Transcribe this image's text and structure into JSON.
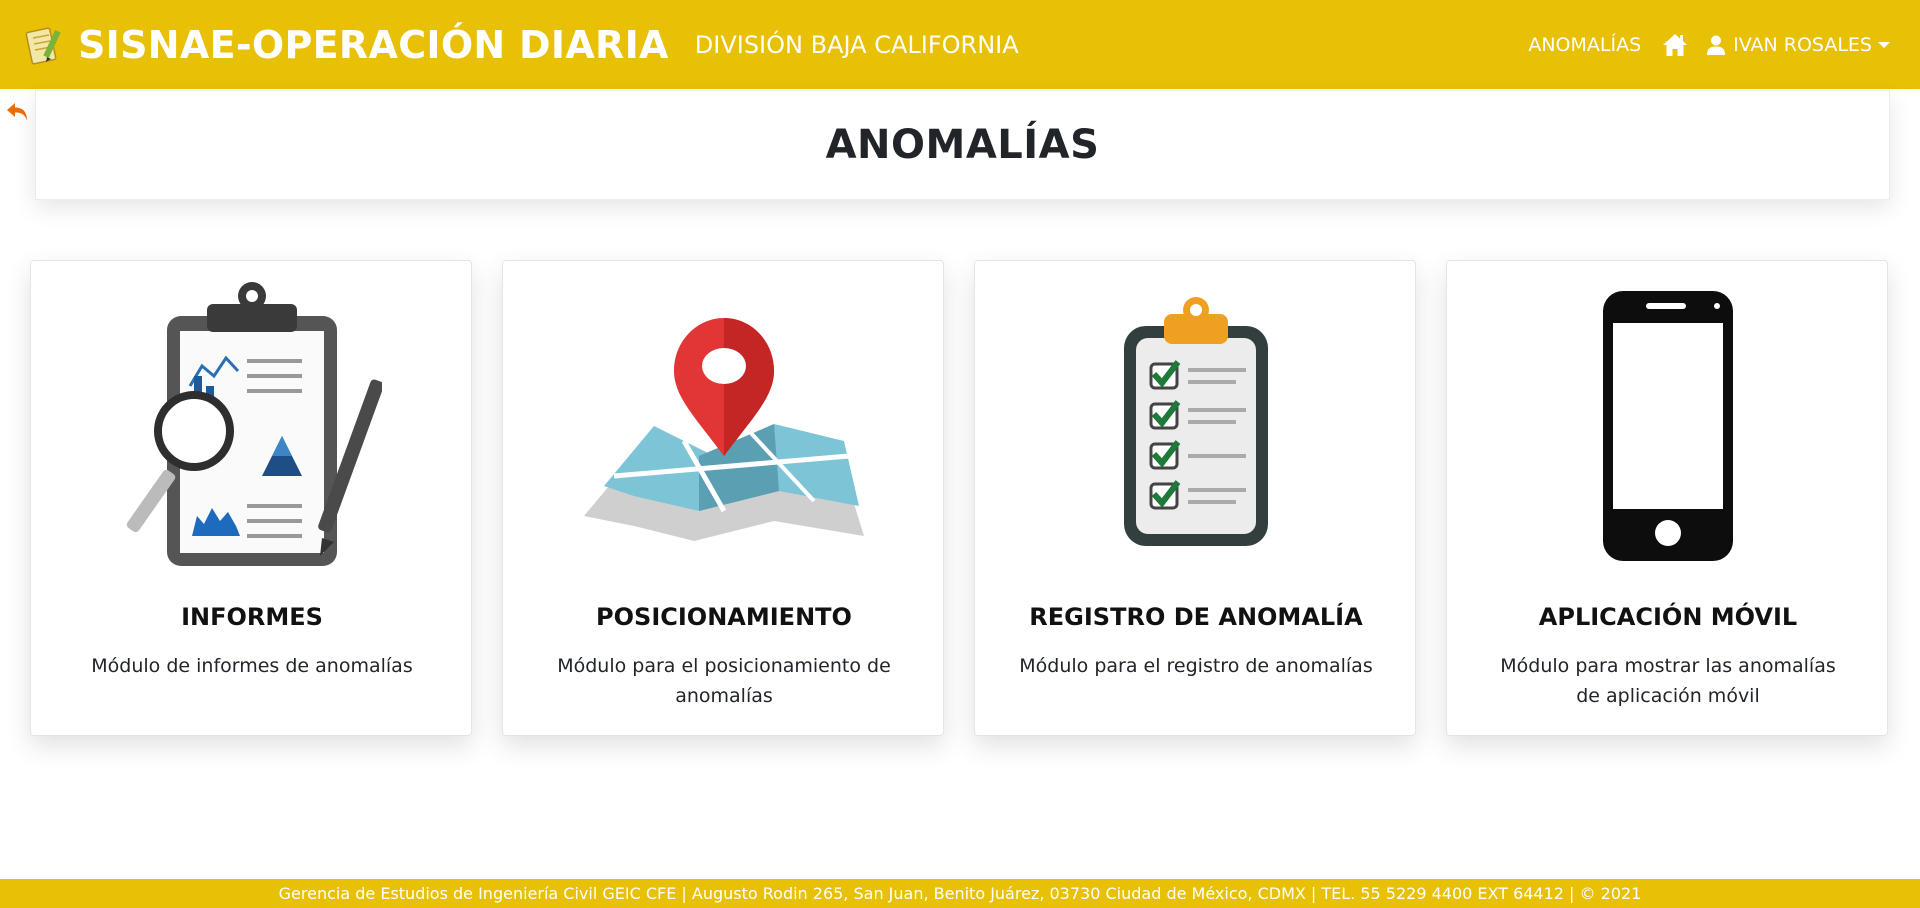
{
  "header": {
    "app_title": "SISNAE-OPERACIÓN DIARIA",
    "division": "DIVISIÓN BAJA CALIFORNIA",
    "nav_anomalias": "ANOMALÍAS",
    "user_name": "IVAN ROSALES",
    "logo_icon": "notepad-pencil-icon",
    "home_icon": "home-icon",
    "user_icon": "user-icon",
    "brand_color": "#e8c006"
  },
  "page": {
    "title": "ANOMALÍAS",
    "back_icon": "undo-arrow-icon"
  },
  "cards": [
    {
      "title": "INFORMES",
      "description": "Módulo de informes de anomalías",
      "icon": "clipboard-report-magnifier-icon"
    },
    {
      "title": "POSICIONAMIENTO",
      "description": "Módulo para el posicionamiento de anomalías",
      "icon": "map-pin-icon"
    },
    {
      "title": "REGISTRO DE ANOMALÍA",
      "description": "Módulo para el registro de anomalías",
      "icon": "clipboard-checklist-icon"
    },
    {
      "title": "APLICACIÓN MÓVIL",
      "description": "Módulo para mostrar las anomalías de aplicación móvil",
      "icon": "smartphone-icon"
    }
  ],
  "footer": {
    "text": "Gerencia de Estudios de Ingeniería Civil GEIC CFE | Augusto Rodin 265, San Juan, Benito Juárez, 03730 Ciudad de México, CDMX | TEL. 55 5229 4400 EXT 64412 | © 2021"
  }
}
